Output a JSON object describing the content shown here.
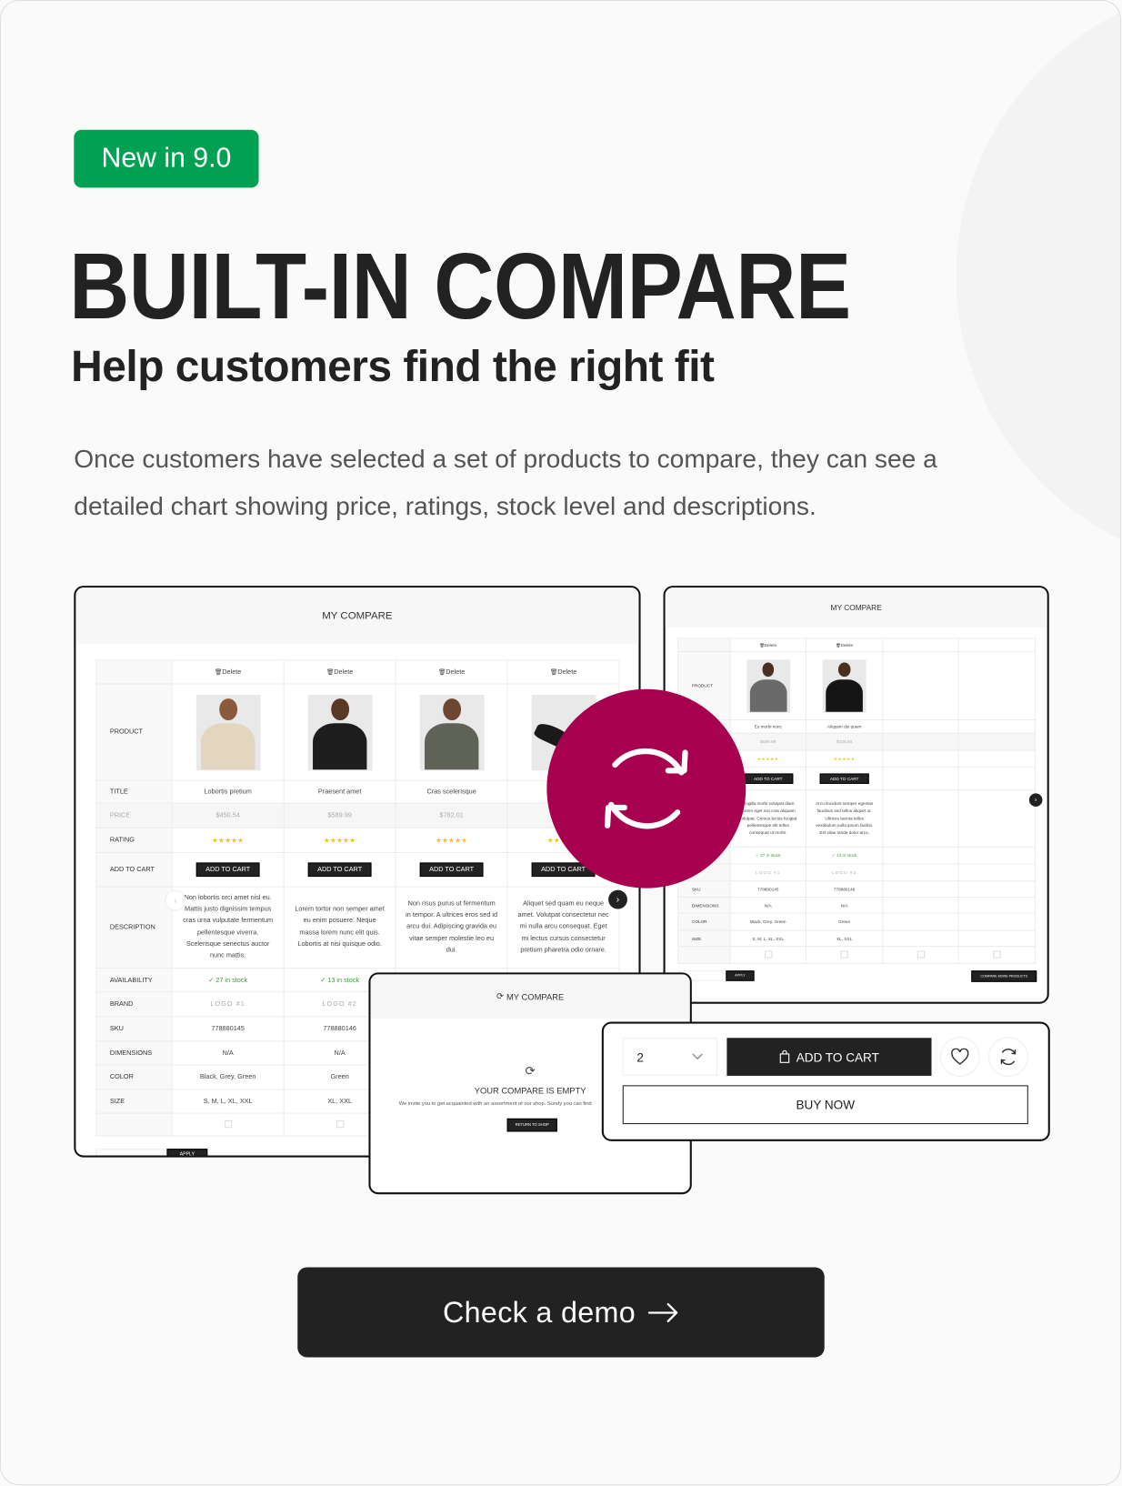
{
  "colors": {
    "accent_green": "#00a152",
    "compare_magenta": "#a6004e",
    "dark": "#222222",
    "star": "#f5c400",
    "stock_green": "#3a9a3a"
  },
  "badge": "New in 9.0",
  "title": "BUILT-IN COMPARE",
  "subtitle": "Help customers find the right fit",
  "description_lines": [
    "Once customers have selected a set of products to compare, they can see a",
    "detailed chart showing price, ratings, stock level and descriptions."
  ],
  "big_icon": "refresh-icon",
  "left_compare": {
    "heading": "MY COMPARE",
    "labels": [
      "",
      "PRODUCT",
      "TITLE",
      "PRICE",
      "RATING",
      "ADD TO CART",
      "DESCRIPTION",
      "AVAILABILITY",
      "BRAND",
      "SKU",
      "DIMENSIONS",
      "COLOR",
      "SIZE",
      ""
    ],
    "delete_label": "Delete",
    "add_to_cart_label": "ADD TO CART",
    "apply_label": "APPLY",
    "columns": [
      {
        "title": "Lobortis pretium",
        "price": "$450.54",
        "rating": 5,
        "photo": "beige-hoodie",
        "description": "Non lobortis orci amet nisl eu. Mattis justo dignissim tempus cras urna vulputate fermentum pellentesque viverra. Scelerisque senectus auctor nunc mattis.",
        "availability": "27 in stock",
        "brand": "LOGO #1",
        "sku": "778880145",
        "dimensions": "N/A",
        "color": "Black, Grey, Green",
        "size": "S, M, L, XL, XXL"
      },
      {
        "title": "Praesent amet",
        "price": "$589.99",
        "rating": 5,
        "photo": "black-hoodie",
        "description": "Lorem tortor non semper amet eu enim posuere. Neque massa lorem nunc elit quis. Lobortis at nisi quisque odio.",
        "availability": "13 in stock",
        "brand": "LOGO #2",
        "sku": "778880146",
        "dimensions": "N/A",
        "color": "Green",
        "size": "XL, XXL"
      },
      {
        "title": "Cras scelerisque",
        "price": "$782.01",
        "rating": 5,
        "photo": "grey-sweatshirt",
        "description": "Non risus purus ut fermentum in tempor. A ultrices eros sed id arcu dui. Adipiscing gravida eu vitae semper molestie leo eu dui."
      },
      {
        "title": "E",
        "price": "",
        "rating": 5,
        "photo": "sneakers",
        "description": "Aliquet sed quam eu neque amet. Volutpat consectetur nec mi nulla arcu consequat. Eget mi lectus cursus consectetur pretium pharetra odio ornare."
      }
    ]
  },
  "right_compare": {
    "heading": "MY COMPARE",
    "labels": [
      "",
      "PRODUCT",
      "",
      "",
      "",
      "",
      "",
      "",
      "",
      "SKU",
      "DIMENSIONS",
      "COLOR",
      "SIZE",
      ""
    ],
    "delete_label": "Delete",
    "add_to_cart_label": "ADD TO CART",
    "apply_label": "APPLY",
    "compare_more_label": "COMPARE MORE PRODUCTS",
    "columns": [
      {
        "title": "Eu morbi nunc",
        "price": "$589.99",
        "rating": 5,
        "photo": "plaid-shirt",
        "description": "Fringilla morbi volutpat diam. Lorem eget nisi cras aliquam volutpat. Cursus lectus feugiat pellentesque elit tellus consequat ut morbi.",
        "availability": "27 in stock",
        "brand": "LOGO #1",
        "sku": "778880145",
        "dimensions": "N/A",
        "color": "Black, Grey, Green",
        "size": "S, M, L, XL, XXL"
      },
      {
        "title": "Aliquam dui quam",
        "price": "$106.58",
        "rating": 5,
        "photo": "black-jacket",
        "description": "Arcu tincidunt semper egestas faucibus sed tellus aliquet ut. Ultrices lacinia tellus vestibulum nulla ipsum facilisi. Est vitae tanda dolor arcu.",
        "availability": "13 in stock",
        "brand": "LOGO #2",
        "sku": "778880146",
        "dimensions": "N/A",
        "color": "Green",
        "size": "XL, XXL"
      }
    ]
  },
  "empty_compare": {
    "heading": "MY COMPARE",
    "message": "YOUR COMPARE IS EMPTY",
    "invite": "We invite you to get acquainted with an assortment of our shop. Surely you can find",
    "return_label": "RETURN TO SHOP"
  },
  "buy_box": {
    "quantity": "2",
    "add_to_cart_label": "ADD TO CART",
    "buy_now_label": "BUY NOW"
  },
  "cta": {
    "label": "Check a demo"
  }
}
